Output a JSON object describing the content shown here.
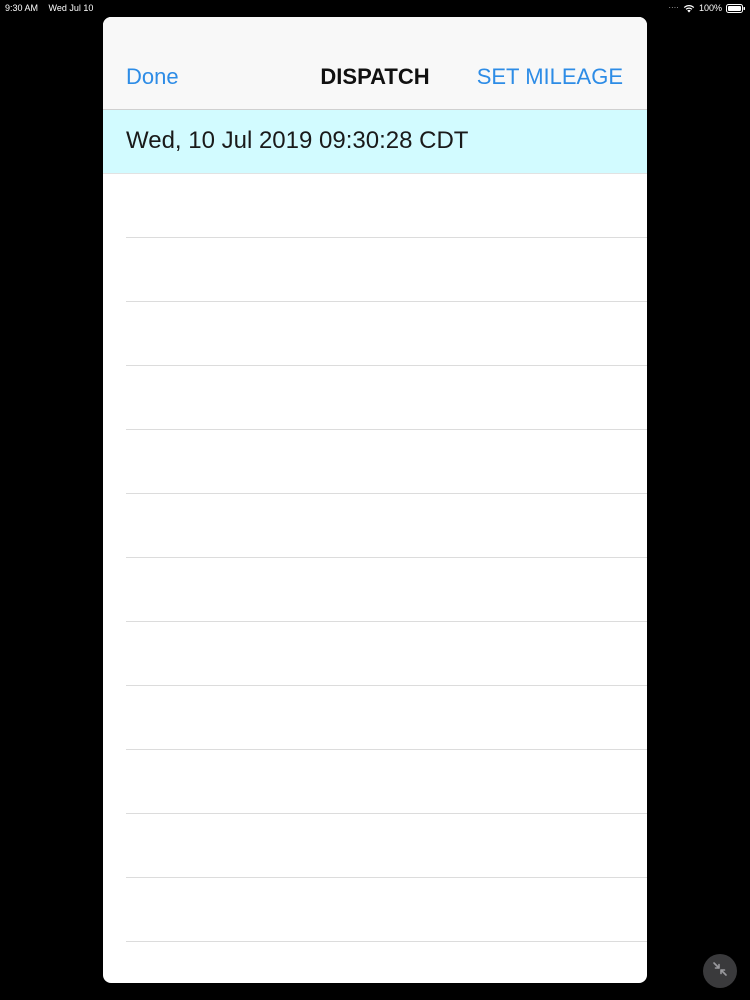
{
  "status_bar": {
    "time": "9:30 AM",
    "date": "Wed Jul 10",
    "signal": "····",
    "battery": "100%",
    "icons": [
      "wifi-icon",
      "battery-icon"
    ]
  },
  "nav": {
    "left_label": "Done",
    "title": "DISPATCH",
    "right_label": "SET MILEAGE"
  },
  "list": {
    "rows": [
      {
        "text": "Wed, 10 Jul 2019 09:30:28 CDT",
        "selected": true
      },
      {
        "text": ""
      },
      {
        "text": ""
      },
      {
        "text": ""
      },
      {
        "text": ""
      },
      {
        "text": ""
      },
      {
        "text": ""
      },
      {
        "text": ""
      },
      {
        "text": ""
      },
      {
        "text": ""
      },
      {
        "text": ""
      },
      {
        "text": ""
      },
      {
        "text": ""
      }
    ]
  },
  "colors": {
    "accent": "#2d8ce6",
    "selected_row": "#d2fbff",
    "background": "#000000"
  },
  "floating_button": {
    "icon": "minimize-arrows-icon"
  }
}
